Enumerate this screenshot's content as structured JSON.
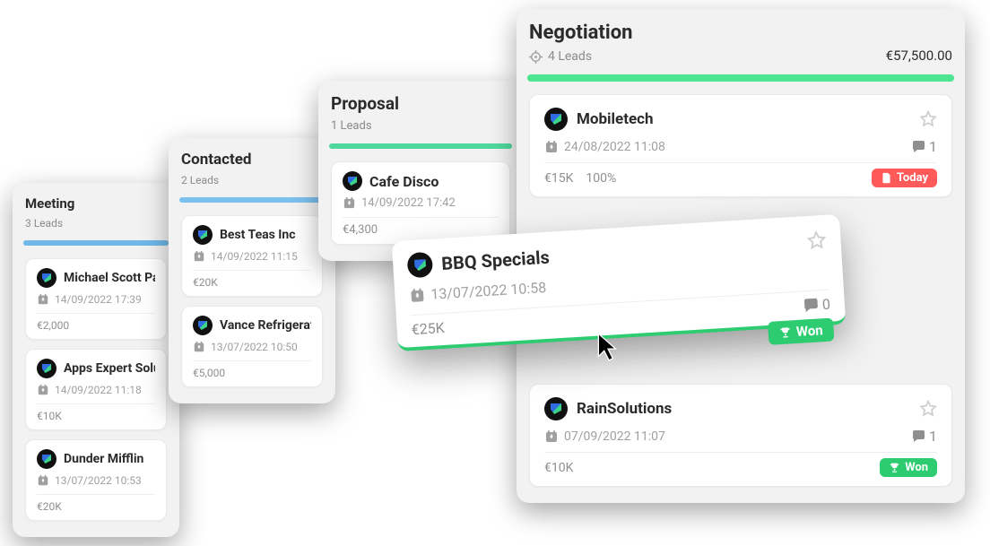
{
  "columns": {
    "meeting": {
      "title": "Meeting",
      "leads_label": "3 Leads",
      "bar_color": "#6fb8e8",
      "cards": [
        {
          "name": "Michael Scott Paper",
          "date": "14/09/2022 17:39",
          "amount": "€2,000"
        },
        {
          "name": "Apps Expert Solutions",
          "date": "14/09/2022 11:18",
          "amount": "€10K"
        },
        {
          "name": "Dunder Mifflin",
          "date": "13/07/2022 10:53",
          "amount": "€20K"
        }
      ]
    },
    "contacted": {
      "title": "Contacted",
      "leads_label": "2 Leads",
      "bar_color": "#7cc0ee",
      "cards": [
        {
          "name": "Best Teas Inc",
          "date": "14/09/2022 11:15",
          "amount": "€20K"
        },
        {
          "name": "Vance Refrigeration",
          "date": "13/07/2022 10:50",
          "amount": "€5,000"
        }
      ]
    },
    "proposal": {
      "title": "Proposal",
      "leads_label": "1 Leads",
      "bar_color": "#4fd89e",
      "cards": [
        {
          "name": "Cafe Disco",
          "date": "14/09/2022 17:42",
          "amount": "€4,300"
        }
      ]
    },
    "negotiation": {
      "title": "Negotiation",
      "leads_label": "4 Leads",
      "total": "€57,500.00",
      "bar_color": "#4de58f",
      "cards": [
        {
          "name": "Mobiletech",
          "date": "24/08/2022 11:08",
          "amount": "€15K",
          "pct": "100%",
          "comments": "1",
          "badge": {
            "kind": "red",
            "label": "Today"
          }
        },
        {
          "name": "RainSolutions",
          "date": "07/09/2022 11:07",
          "amount": "€10K",
          "comments": "1",
          "badge": {
            "kind": "green",
            "label": "Won"
          }
        }
      ]
    }
  },
  "dragging": {
    "name": "BBQ Specials",
    "date": "13/07/2022 10:58",
    "amount": "€25K",
    "comments": "0",
    "badge_label": "Won"
  }
}
